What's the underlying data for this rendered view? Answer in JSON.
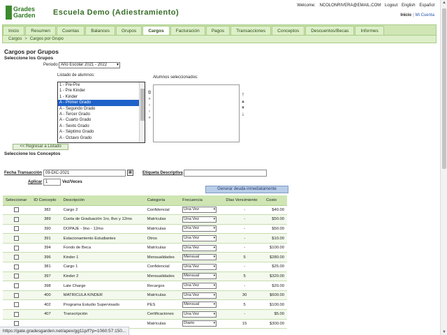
{
  "header": {
    "logo_line1": "Grades",
    "logo_line2": "Garden",
    "school_name": "Escuela Demo (Adiestramiento)",
    "welcome_label": "Welcome:",
    "user_email": "NCOLONRIVERA@EMAIL.COM",
    "logout": "Logout",
    "lang_en": "English",
    "lang_es": "Español",
    "inicio": "Inicio",
    "sep": "|",
    "mi_cuenta": "Mi Cuenta"
  },
  "nav": {
    "tabs": [
      "Inicio",
      "Resumen",
      "Cuentas",
      "Balances",
      "Grupos",
      "Cargos",
      "Facturación",
      "Pagos",
      "Transacciones",
      "Conceptos",
      "Descuentos/Becas",
      "Informes"
    ],
    "active": "Cargos"
  },
  "breadcrumb": {
    "item1": "Cargos",
    "arrow": ">",
    "item2": "Cargos por Grupo"
  },
  "page": {
    "title": "Cargos por Grupos",
    "select_groups": "Seleccione los Grupos",
    "periodo_label": "Periodo",
    "periodo_value": "Año Escolar 2021 - 2022",
    "listado_label": "Listado de alumnos:",
    "seleccionados_label": "Alumnos seleccionados:",
    "groups": [
      "1 - Pre-Pre",
      "1 - Pre Kinder",
      "1 - Kinder",
      "A - Primer Grado",
      "A - Segundo Grado",
      "A - Tercer Grado",
      "A - Cuarto Grado",
      "A - Sexto Grado",
      "A - Séptimo Grado",
      "A - Octavo Grado"
    ],
    "selected_group_index": 3,
    "regresar_button": "<< Regresar a Listado",
    "select_concepts": "Seleccione los Conceptos",
    "fecha_label": "Fecha Transacción",
    "fecha_value": "09-DIC-2021",
    "etiqueta_label": "Etiqueta Descriptiva",
    "etiqueta_value": "",
    "aplicar_label": "Aplicar",
    "aplicar_value": "1",
    "vez_label": "Vez/Veces",
    "generar_button": "Generar deuda inmediatamente"
  },
  "table": {
    "headers": [
      "Seleccionar",
      "ID Concepto",
      "Descripción",
      "Categoría",
      "Frecuencia",
      "Días Vencimiento",
      "Costo"
    ],
    "rows": [
      {
        "id": "382",
        "desc": "Cargo 2",
        "cat": "Confidencial",
        "freq": "Una Vez",
        "venc": "-",
        "costo": "$40.00"
      },
      {
        "id": "389",
        "desc": "Cuota de Graduación 1ro, 8vo y 12mo",
        "cat": "Matrículas",
        "freq": "Una Vez",
        "venc": "-",
        "costo": "$50.00"
      },
      {
        "id": "390",
        "desc": "DOPAJE - 9no - 12mo",
        "cat": "Matrículas",
        "freq": "Una Vez",
        "venc": "-",
        "costo": "$50.00"
      },
      {
        "id": "391",
        "desc": "Estacionamiento Estudiantes",
        "cat": "Otros",
        "freq": "Una Vez",
        "venc": "-",
        "costo": "$10.00"
      },
      {
        "id": "394",
        "desc": "Fondo de Beca",
        "cat": "Matrículas",
        "freq": "Una Vez",
        "venc": "-",
        "costo": "$100.00"
      },
      {
        "id": "396",
        "desc": "Kinder 1",
        "cat": "Mensualidades",
        "freq": "Mensual",
        "venc": "5",
        "costo": "$280.00"
      },
      {
        "id": "381",
        "desc": "Cargo 1",
        "cat": "Confidencial",
        "freq": "Una Vez",
        "venc": "-",
        "costo": "$25.00"
      },
      {
        "id": "397",
        "desc": "Kinder 2",
        "cat": "Mensualidades",
        "freq": "Mensual",
        "venc": "5",
        "costo": "$320.00"
      },
      {
        "id": "398",
        "desc": "Late Charge",
        "cat": "Recargos",
        "freq": "Una Vez",
        "venc": "-",
        "costo": "$20.00"
      },
      {
        "id": "400",
        "desc": "MATRICULA KINDER",
        "cat": "Matrículas",
        "freq": "Una Vez",
        "venc": "30",
        "costo": "$600.00"
      },
      {
        "id": "402",
        "desc": "Programa Estudio Supervisado",
        "cat": "PES",
        "freq": "Mensual",
        "venc": "5",
        "costo": "$100.00"
      },
      {
        "id": "407",
        "desc": "Transcripción",
        "cat": "Certificaciones",
        "freq": "Una Vez",
        "venc": "-",
        "costo": "$5.00"
      },
      {
        "id": "",
        "desc": "",
        "cat": "Matrículas",
        "freq": "Diario",
        "venc": "15",
        "costo": "$300.00"
      }
    ]
  },
  "status_url": "https://gate.gradesgarden.net/apex/gg11p/f?p=1060:57:150..."
}
